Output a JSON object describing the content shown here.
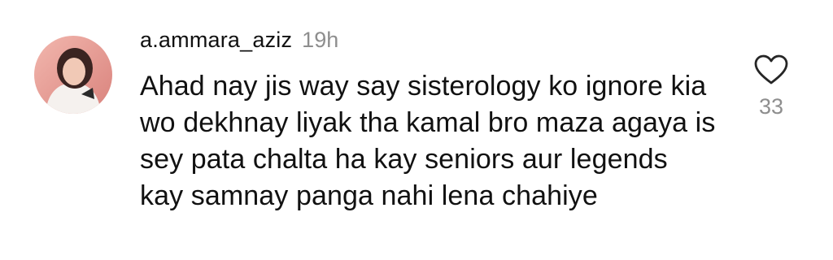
{
  "comment": {
    "username": "a.ammara_aziz",
    "timestamp": "19h",
    "text": "Ahad nay jis way say sisterology ko ignore kia wo dekhnay liyak tha kamal bro maza agaya is sey pata chalta ha kay seniors aur legends kay samnay panga nahi lena chahiye",
    "like_icon": "heart-outline-icon",
    "like_count": "33",
    "avatar_icon": "profile-photo-avatar"
  },
  "colors": {
    "text_primary": "#111111",
    "text_secondary": "#8e8e8e",
    "background": "#ffffff"
  }
}
